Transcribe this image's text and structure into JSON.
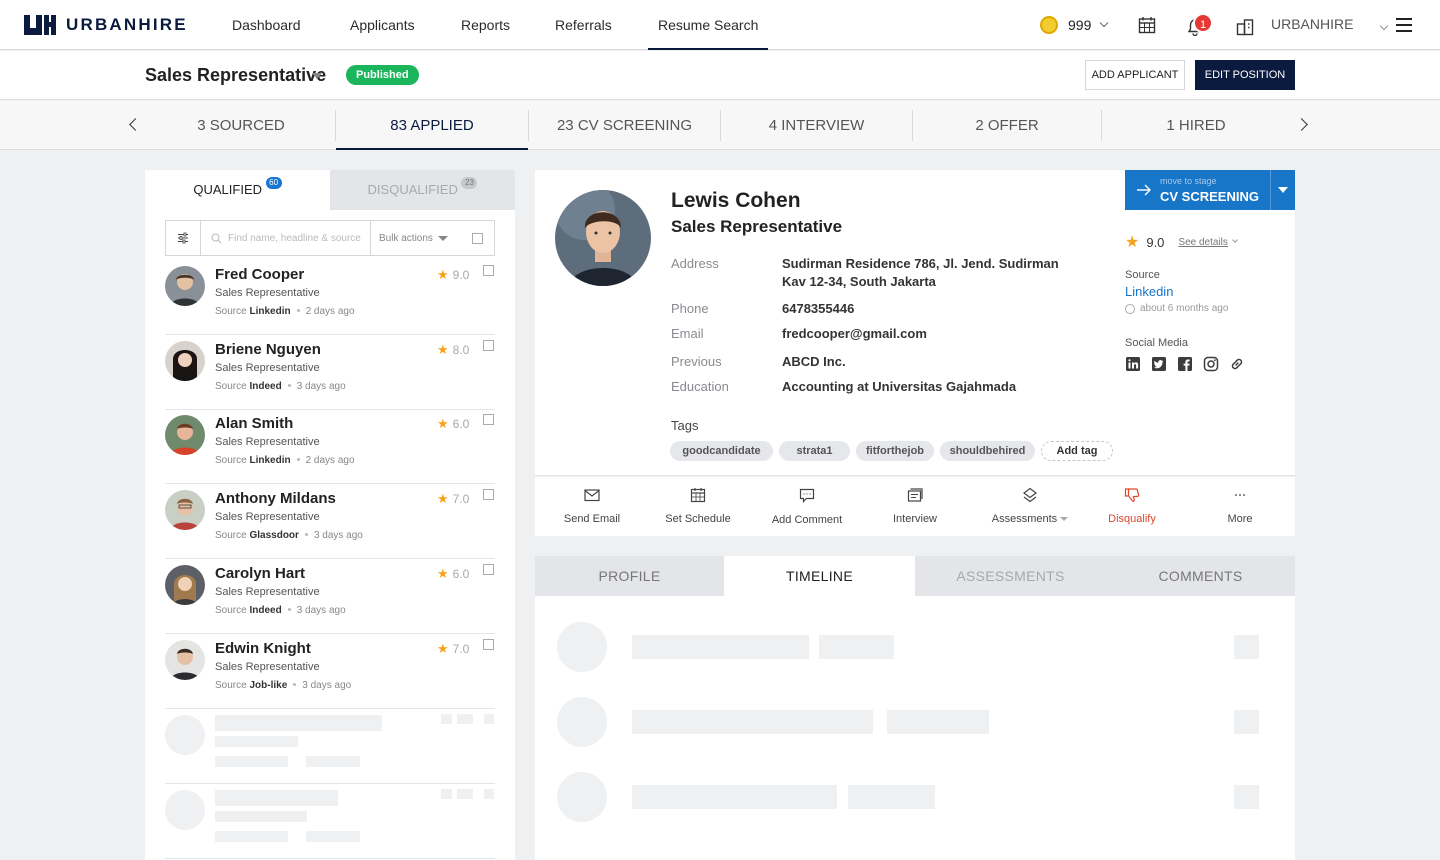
{
  "brand": {
    "name": "URBANHIRE",
    "accent": "#0b1a3f",
    "blue": "#1876c8"
  },
  "nav": {
    "links": [
      "Dashboard",
      "Applicants",
      "Reports",
      "Referrals",
      "Resume Search"
    ],
    "active": "Resume Search",
    "coins": "999",
    "notifications": "1",
    "company": "URBANHIRE"
  },
  "position": {
    "title": "Sales Representative",
    "status": "Published",
    "add_applicant": "ADD APPLICANT",
    "edit_position": "EDIT POSITION"
  },
  "stages": [
    {
      "label": "3 SOURCED"
    },
    {
      "label": "83 APPLIED",
      "active": true
    },
    {
      "label": "23 CV SCREENING"
    },
    {
      "label": "4 INTERVIEW"
    },
    {
      "label": "2 OFFER"
    },
    {
      "label": "1 HIRED"
    }
  ],
  "left": {
    "tab_qualified": "QUALIFIED",
    "qualified_count": "60",
    "tab_disqualified": "DISQUALIFIED",
    "disqualified_count": "23",
    "search_placeholder": "Find name, headline & source",
    "bulk_actions": "Bulk actions",
    "source_label": "Source",
    "candidates": [
      {
        "name": "Fred Cooper",
        "role": "Sales Representative",
        "source": "Linkedin",
        "time": "2 days ago",
        "score": "9.0"
      },
      {
        "name": "Briene Nguyen",
        "role": "Sales Representative",
        "source": "Indeed",
        "time": "3 days ago",
        "score": "8.0"
      },
      {
        "name": "Alan Smith",
        "role": "Sales Representative",
        "source": "Linkedin",
        "time": "2 days ago",
        "score": "6.0"
      },
      {
        "name": "Anthony Mildans",
        "role": "Sales Representative",
        "source": "Glassdoor",
        "time": "3 days ago",
        "score": "7.0"
      },
      {
        "name": "Carolyn Hart",
        "role": "Sales Representative",
        "source": "Indeed",
        "time": "3 days ago",
        "score": "6.0"
      },
      {
        "name": "Edwin Knight",
        "role": "Sales Representative",
        "source": "Job-like",
        "time": "3 days ago",
        "score": "7.0"
      }
    ]
  },
  "profile": {
    "name": "Lewis Cohen",
    "role": "Sales Representative",
    "fields": [
      {
        "label": "Address",
        "value": "Sudirman Residence 786, Jl. Jend. Sudirman",
        "value2": "Kav 12-34, South Jakarta"
      },
      {
        "label": "Phone",
        "value": "6478355446"
      },
      {
        "label": "Email",
        "value": "fredcooper@gmail.com"
      },
      {
        "label": "Previous",
        "value": "ABCD Inc."
      },
      {
        "label": "Education",
        "value": "Accounting at Universitas Gajahmada"
      }
    ],
    "tags_label": "Tags",
    "tags": [
      "goodcandidate",
      "strata1",
      "fitforthejob",
      "shouldbehired"
    ],
    "add_tag": "Add tag",
    "move_small": "move to stage",
    "move_stage": "CV SCREENING",
    "score": "9.0",
    "see_details": "See details",
    "source_label": "Source",
    "source": "Linkedin",
    "source_time": "about 6 months ago",
    "social_label": "Social Media"
  },
  "actions": [
    {
      "label": "Send Email",
      "icon": "mail-icon"
    },
    {
      "label": "Set Schedule",
      "icon": "calendar-icon"
    },
    {
      "label": "Add Comment",
      "icon": "comment-icon"
    },
    {
      "label": "Interview",
      "icon": "interview-icon"
    },
    {
      "label": "Assessments",
      "icon": "assessments-icon"
    },
    {
      "label": "Disqualify",
      "icon": "thumbs-down-icon"
    },
    {
      "label": "More",
      "icon": "more-icon"
    }
  ],
  "bottom_tabs": [
    "PROFILE",
    "TIMELINE",
    "ASSESSMENTS",
    "COMMENTS"
  ],
  "bottom_active": "TIMELINE"
}
